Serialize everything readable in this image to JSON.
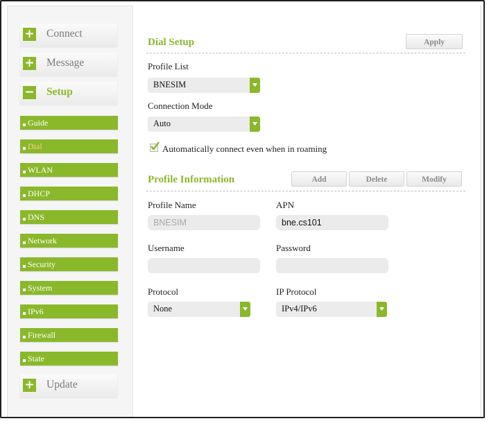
{
  "sidebar": {
    "connect": {
      "label": "Connect",
      "icon": "+"
    },
    "message": {
      "label": "Message",
      "icon": "+"
    },
    "setup": {
      "label": "Setup",
      "icon": "−"
    },
    "items": [
      {
        "label": "Guide"
      },
      {
        "label": "Dial"
      },
      {
        "label": "WLAN"
      },
      {
        "label": "DHCP"
      },
      {
        "label": "DNS"
      },
      {
        "label": "Network"
      },
      {
        "label": "Security"
      },
      {
        "label": "System"
      },
      {
        "label": "IPv6"
      },
      {
        "label": "Firewall"
      },
      {
        "label": "State"
      }
    ],
    "update": {
      "label": "Update",
      "icon": "+"
    }
  },
  "dial_setup": {
    "title": "Dial Setup",
    "apply_label": "Apply",
    "profile_list_label": "Profile List",
    "profile_list_value": "BNESIM",
    "connection_mode_label": "Connection Mode",
    "connection_mode_value": "Auto",
    "auto_connect_label": "Automatically connect even when in roaming",
    "auto_connect_checked": true
  },
  "profile_info": {
    "title": "Profile Information",
    "add_label": "Add",
    "delete_label": "Delete",
    "modify_label": "Modify",
    "profile_name_label": "Profile Name",
    "profile_name_value": "BNESIM",
    "apn_label": "APN",
    "apn_value": "bne.cs101",
    "username_label": "Username",
    "username_value": "",
    "password_label": "Password",
    "password_value": "",
    "protocol_label": "Protocol",
    "protocol_value": "None",
    "ip_protocol_label": "IP Protocol",
    "ip_protocol_value": "IPv4/IPv6"
  },
  "colors": {
    "accent": "#8ab82b",
    "active_sub_text": "#ffd08a"
  }
}
